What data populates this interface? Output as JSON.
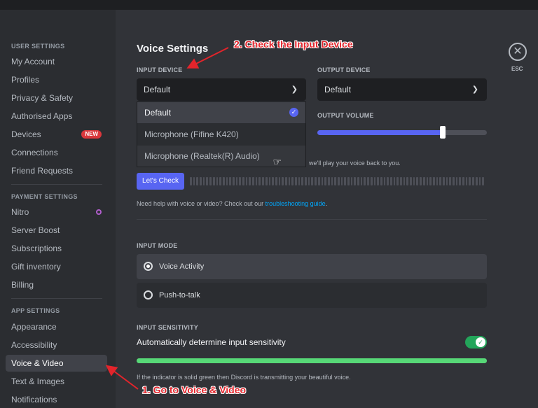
{
  "sidebar": {
    "sections": [
      {
        "header": "User Settings",
        "items": [
          "My Account",
          "Profiles",
          "Privacy & Safety",
          "Authorised Apps",
          "Devices",
          "Connections",
          "Friend Requests"
        ]
      },
      {
        "header": "Payment Settings",
        "items": [
          "Nitro",
          "Server Boost",
          "Subscriptions",
          "Gift inventory",
          "Billing"
        ]
      },
      {
        "header": "App Settings",
        "items": [
          "Appearance",
          "Accessibility",
          "Voice & Video",
          "Text & Images",
          "Notifications"
        ]
      }
    ],
    "devices_badge": "NEW",
    "selected_item": "Voice & Video"
  },
  "main": {
    "title": "Voice Settings",
    "input_device": {
      "label": "Input Device",
      "value": "Default",
      "options": [
        "Default",
        "Microphone (Fifine K420)",
        "Microphone (Realtek(R) Audio)"
      ]
    },
    "output_device": {
      "label": "Output Device",
      "value": "Default"
    },
    "output_volume": {
      "label": "Output Volume",
      "level": 0.74
    },
    "mic_test_text": "we'll play your voice back to you.",
    "lets_check_button": "Let's Check",
    "help_text": "Need help with voice or video? Check out our ",
    "help_link": "troubleshooting guide",
    "help_suffix": ".",
    "input_mode": {
      "label": "Input Mode",
      "options": [
        "Voice Activity",
        "Push-to-talk"
      ],
      "selected": "Voice Activity"
    },
    "input_sensitivity": {
      "label": "Input Sensitivity",
      "auto_label": "Automatically determine input sensitivity",
      "auto_enabled": true,
      "level": 1.0,
      "note": "If the indicator is solid green then Discord is transmitting your beautiful voice."
    },
    "esc": {
      "icon": "close-icon",
      "label": "ESC"
    }
  },
  "annotations": {
    "step1": "1. Go to Voice & Video",
    "step2": "2. Check the Input Device"
  },
  "colors": {
    "accent": "#5865f2",
    "annotation": "#e3242b",
    "green": "#23a55a",
    "badge": "#da373c"
  }
}
